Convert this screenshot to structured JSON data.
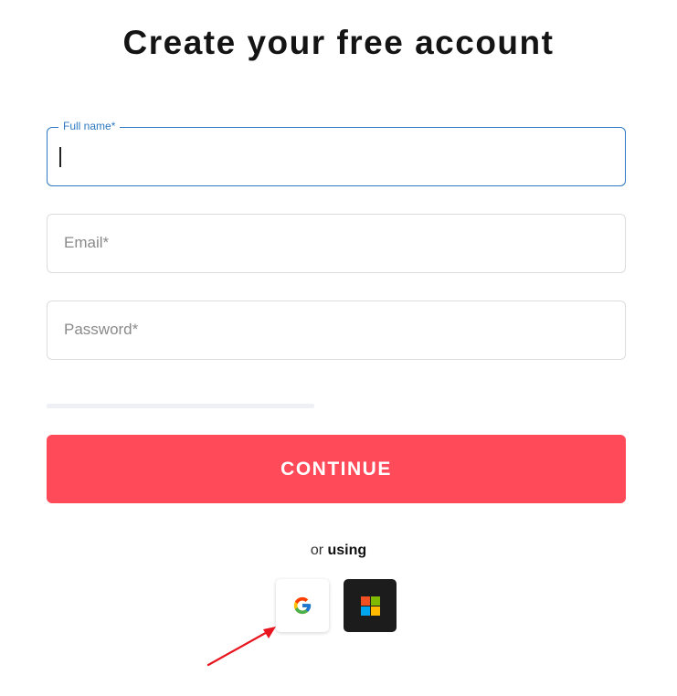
{
  "page": {
    "title": "Create your free account"
  },
  "form": {
    "full_name": {
      "label": "Full name*",
      "value": ""
    },
    "email": {
      "placeholder": "Email*",
      "value": ""
    },
    "password": {
      "placeholder": "Password*",
      "value": ""
    },
    "continue_label": "CONTINUE"
  },
  "social": {
    "or_text": "or",
    "using_text": "using",
    "providers": [
      {
        "name": "Google",
        "icon": "google-icon"
      },
      {
        "name": "Microsoft",
        "icon": "microsoft-icon"
      }
    ]
  },
  "colors": {
    "accent_blue": "#2e79c2",
    "continue_red": "#ff4a5a",
    "annotation_arrow": "#e8141e"
  }
}
